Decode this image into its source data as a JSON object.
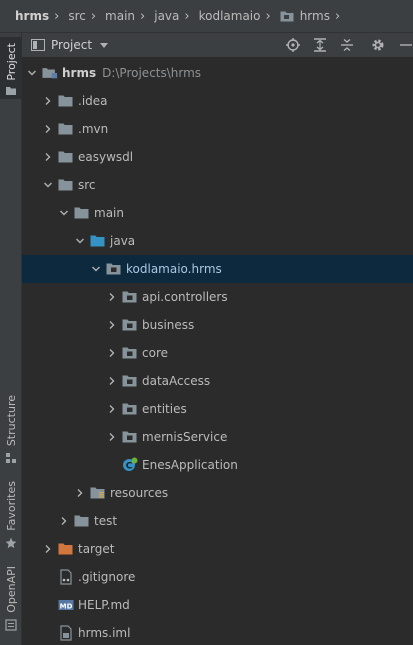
{
  "breadcrumb": [
    "hrms",
    "src",
    "main",
    "java",
    "kodlamaio",
    "hrms"
  ],
  "sidebar": {
    "project": "Project",
    "structure": "Structure",
    "favorites": "Favorites",
    "openapi": "OpenAPI"
  },
  "header": {
    "title": "Project",
    "icons": [
      "locate-icon",
      "expand-all-icon",
      "collapse-all-icon",
      "settings-icon",
      "minimize-icon"
    ]
  },
  "tree": [
    {
      "label": "hrms",
      "path": "D:\\Projects\\hrms",
      "depth": 0,
      "expanded": true,
      "icon": "module-folder",
      "bold": true
    },
    {
      "label": ".idea",
      "depth": 1,
      "expanded": false,
      "icon": "folder"
    },
    {
      "label": ".mvn",
      "depth": 1,
      "expanded": false,
      "icon": "folder"
    },
    {
      "label": "easywsdl",
      "depth": 1,
      "expanded": false,
      "icon": "folder"
    },
    {
      "label": "src",
      "depth": 1,
      "expanded": true,
      "icon": "folder"
    },
    {
      "label": "main",
      "depth": 2,
      "expanded": true,
      "icon": "folder"
    },
    {
      "label": "java",
      "depth": 3,
      "expanded": true,
      "icon": "source-folder"
    },
    {
      "label": "kodlamaio.hrms",
      "depth": 4,
      "expanded": true,
      "icon": "package",
      "selected": true
    },
    {
      "label": "api.controllers",
      "depth": 5,
      "expanded": false,
      "icon": "package"
    },
    {
      "label": "business",
      "depth": 5,
      "expanded": false,
      "icon": "package"
    },
    {
      "label": "core",
      "depth": 5,
      "expanded": false,
      "icon": "package"
    },
    {
      "label": "dataAccess",
      "depth": 5,
      "expanded": false,
      "icon": "package"
    },
    {
      "label": "entities",
      "depth": 5,
      "expanded": false,
      "icon": "package"
    },
    {
      "label": "mernisService",
      "depth": 5,
      "expanded": false,
      "icon": "package"
    },
    {
      "label": "EnesApplication",
      "depth": 5,
      "leaf": true,
      "icon": "spring-class"
    },
    {
      "label": "resources",
      "depth": 3,
      "expanded": false,
      "icon": "resources-folder"
    },
    {
      "label": "test",
      "depth": 2,
      "expanded": false,
      "icon": "folder"
    },
    {
      "label": "target",
      "depth": 1,
      "expanded": false,
      "icon": "excluded-folder"
    },
    {
      "label": ".gitignore",
      "depth": 1,
      "leaf": true,
      "icon": "gitignore-file"
    },
    {
      "label": "HELP.md",
      "depth": 1,
      "leaf": true,
      "icon": "markdown-file"
    },
    {
      "label": "hrms.iml",
      "depth": 1,
      "leaf": true,
      "icon": "iml-file"
    }
  ],
  "colors": {
    "background": "#2b2b2b",
    "panel": "#3c3f41",
    "selection": "#0d293e",
    "folder": "#87939a",
    "source_folder": "#3592c4",
    "excluded_folder": "#d1773e"
  }
}
